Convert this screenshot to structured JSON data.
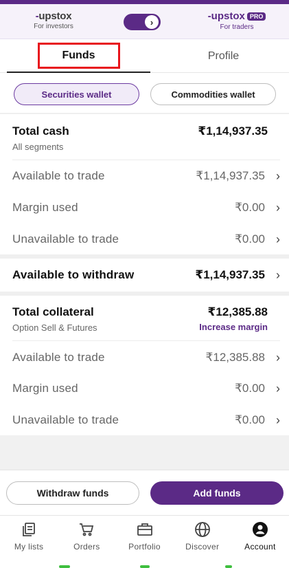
{
  "switcher": {
    "left_brand": "upstox",
    "left_sub": "For investors",
    "right_brand": "upstox",
    "right_badge": "PRO",
    "right_sub": "For traders",
    "toggle_icon": "chevron-right-icon"
  },
  "tabs": [
    {
      "label": "Funds",
      "active": true
    },
    {
      "label": "Profile",
      "active": false
    }
  ],
  "wallets": {
    "securities": "Securities wallet",
    "commodities": "Commodities wallet",
    "selected": "Securities wallet"
  },
  "total_cash": {
    "title": "Total cash",
    "sub": "All segments",
    "amount": "₹1,14,937.35",
    "rows": [
      {
        "label": "Available to trade",
        "value": "₹1,14,937.35"
      },
      {
        "label": "Margin used",
        "value": "₹0.00"
      },
      {
        "label": "Unavailable to trade",
        "value": "₹0.00"
      }
    ]
  },
  "withdraw": {
    "label": "Available to withdraw",
    "value": "₹1,14,937.35"
  },
  "collateral": {
    "title": "Total collateral",
    "sub": "Option Sell & Futures",
    "amount": "₹12,385.88",
    "link": "Increase margin",
    "rows": [
      {
        "label": "Available to trade",
        "value": "₹12,385.88"
      },
      {
        "label": "Margin used",
        "value": "₹0.00"
      },
      {
        "label": "Unavailable to trade",
        "value": "₹0.00"
      }
    ]
  },
  "actions": {
    "withdraw": "Withdraw funds",
    "add": "Add funds"
  },
  "nav": [
    {
      "label": "My lists",
      "icon": "my-lists-icon"
    },
    {
      "label": "Orders",
      "icon": "orders-cart-icon"
    },
    {
      "label": "Portfolio",
      "icon": "portfolio-briefcase-icon"
    },
    {
      "label": "Discover",
      "icon": "discover-globe-icon"
    },
    {
      "label": "Account",
      "icon": "account-icon",
      "active": true
    }
  ],
  "colors": {
    "brand": "#5b2a86",
    "highlight_box": "#e8141c"
  }
}
